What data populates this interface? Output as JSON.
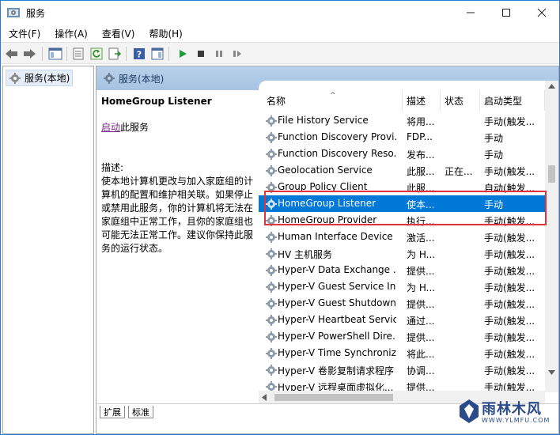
{
  "window": {
    "title": "服务"
  },
  "menu": [
    "文件(F)",
    "操作(A)",
    "查看(V)",
    "帮助(H)"
  ],
  "tree": {
    "root_label": "服务(本地)"
  },
  "main": {
    "header": "服务(本地)"
  },
  "description": {
    "service_name": "HomeGroup Listener",
    "start_link": "启动",
    "start_suffix": "此服务",
    "desc_label": "描述:",
    "desc_text": "使本地计算机更改与加入家庭组的计算机的配置和维护相关联。如果停止或禁用此服务，你的计算机将无法在家庭组中正常工作，且你的家庭组也可能无法正常工作。建议你保持此服务的运行状态。"
  },
  "columns": {
    "name": "名称",
    "desc": "描述",
    "status": "状态",
    "startup": "启动类型"
  },
  "rows": [
    {
      "name": "File History Service",
      "desc": "将用...",
      "status": "",
      "startup": "手动(触发..."
    },
    {
      "name": "Function Discovery Provi...",
      "desc": "FDP...",
      "status": "",
      "startup": "手动"
    },
    {
      "name": "Function Discovery Reso...",
      "desc": "发布...",
      "status": "",
      "startup": "手动"
    },
    {
      "name": "Geolocation Service",
      "desc": "此服...",
      "status": "正在...",
      "startup": "手动(触发..."
    },
    {
      "name": "Group Policy Client",
      "desc": "此服...",
      "status": "",
      "startup": "自动(触发..."
    },
    {
      "name": "HomeGroup Listener",
      "desc": "使本...",
      "status": "",
      "startup": "手动"
    },
    {
      "name": "HomeGroup Provider",
      "desc": "执行...",
      "status": "",
      "startup": "手动(触发..."
    },
    {
      "name": "Human Interface Device ...",
      "desc": "激活...",
      "status": "",
      "startup": "手动(触发..."
    },
    {
      "name": "HV 主机服务",
      "desc": "为 H...",
      "status": "",
      "startup": "手动(触发..."
    },
    {
      "name": "Hyper-V Data Exchange ...",
      "desc": "提供...",
      "status": "",
      "startup": "手动(触发..."
    },
    {
      "name": "Hyper-V Guest Service In...",
      "desc": "为 H...",
      "status": "",
      "startup": "手动(触发..."
    },
    {
      "name": "Hyper-V Guest Shutdown...",
      "desc": "提供...",
      "status": "",
      "startup": "手动(触发..."
    },
    {
      "name": "Hyper-V Heartbeat Service",
      "desc": "通过...",
      "status": "",
      "startup": "手动(触发..."
    },
    {
      "name": "Hyper-V PowerShell Dire...",
      "desc": "提供...",
      "status": "",
      "startup": "手动(触发..."
    },
    {
      "name": "Hyper-V Time Synchroniz...",
      "desc": "将此...",
      "status": "",
      "startup": "手动(触发..."
    },
    {
      "name": "Hyper-V 卷影复制请求程序",
      "desc": "协调...",
      "status": "",
      "startup": "手动(触发..."
    },
    {
      "name": "Hyper-V 远程桌面虚拟化...",
      "desc": "提供...",
      "status": "",
      "startup": "手动(触发..."
    }
  ],
  "selected_index": 5,
  "tabs": [
    "扩展",
    "标准"
  ],
  "watermark": {
    "text": "雨林木风",
    "url": "WWW.YLMFU.COM"
  },
  "colors": {
    "selection": "#0078d7",
    "highlight_box": "#e0333b",
    "header_bg": "#b9d1ea"
  }
}
